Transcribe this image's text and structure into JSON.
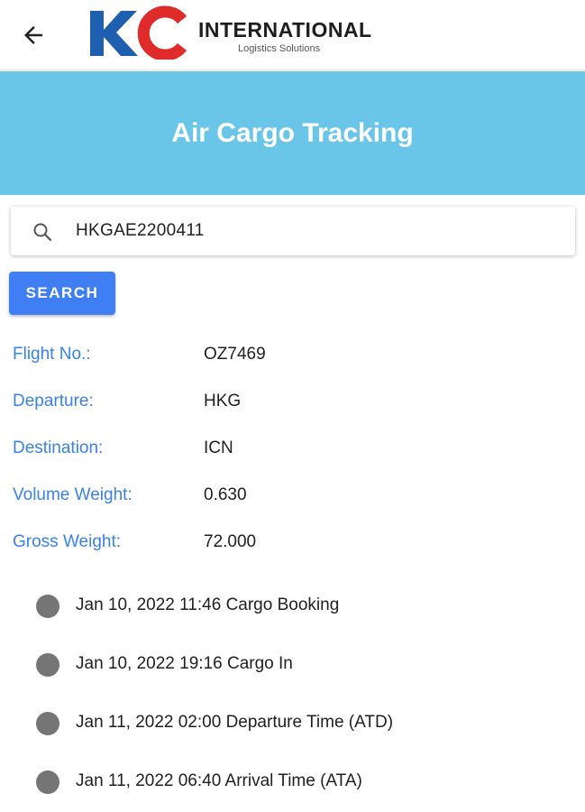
{
  "header": {
    "back_icon": "arrow-left-icon",
    "logo": {
      "mark": "KC",
      "title": "INTERNATIONAL",
      "subtitle": "Logistics Solutions",
      "colors": {
        "k": "#1f5fb0",
        "c": "#e02b2b"
      }
    }
  },
  "banner": {
    "title": "Air Cargo Tracking",
    "color": "#6ac6e8"
  },
  "search": {
    "icon": "search-icon",
    "value": "HKGAE2200411",
    "button_label": "SEARCH",
    "button_color": "#3f7ef3"
  },
  "details": [
    {
      "label": "Flight No.:",
      "value": "OZ7469"
    },
    {
      "label": "Departure:",
      "value": "HKG"
    },
    {
      "label": "Destination:",
      "value": "ICN"
    },
    {
      "label": "Volume Weight:",
      "value": "0.630"
    },
    {
      "label": "Gross Weight:",
      "value": "72.000"
    }
  ],
  "timeline": [
    {
      "text": "Jan 10, 2022 11:46 Cargo Booking"
    },
    {
      "text": "Jan 10, 2022 19:16 Cargo In"
    },
    {
      "text": "Jan 11, 2022 02:00 Departure Time (ATD)"
    },
    {
      "text": "Jan 11, 2022 06:40 Arrival Time (ATA)"
    }
  ],
  "colors": {
    "label": "#3a82e6",
    "dot": "#757575"
  }
}
